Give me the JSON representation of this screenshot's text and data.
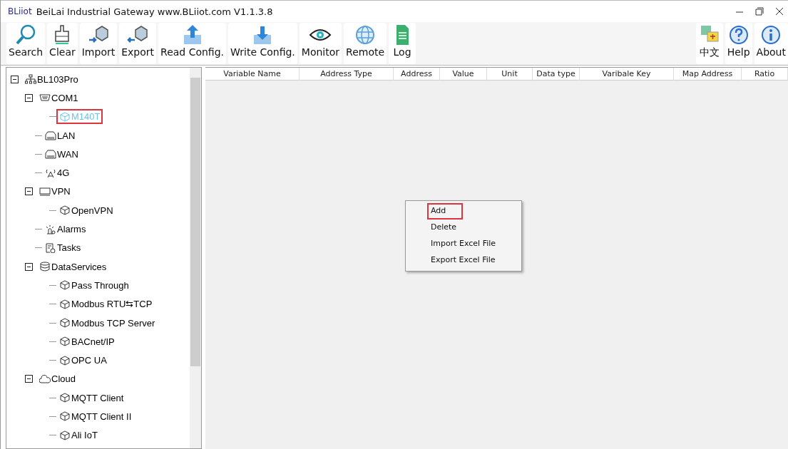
{
  "window": {
    "logo": "BLiiot",
    "title": "BeiLai Industrial Gateway www.BLiiot.com V1.1.3.8"
  },
  "toolbar": [
    {
      "label": "Search",
      "kind": "search"
    },
    {
      "label": "Clear",
      "kind": "clear"
    },
    {
      "label": "Import",
      "kind": "import"
    },
    {
      "label": "Export",
      "kind": "export"
    },
    {
      "label": "Read Config.",
      "kind": "read"
    },
    {
      "label": "Write Config.",
      "kind": "write"
    },
    {
      "label": "Monitor",
      "kind": "monitor"
    },
    {
      "label": "Remote",
      "kind": "remote"
    },
    {
      "label": "Log",
      "kind": "log"
    }
  ],
  "toolbar_right": [
    {
      "label": "中文",
      "kind": "language"
    },
    {
      "label": "Help",
      "kind": "help"
    },
    {
      "label": "About",
      "kind": "about"
    }
  ],
  "tree": [
    {
      "label": "BL103Pro",
      "kind": "network",
      "expanded": true,
      "selected": false,
      "highlighted": false,
      "children": [
        {
          "label": "COM1",
          "kind": "serial",
          "expanded": true,
          "selected": false,
          "highlighted": false,
          "children": [
            {
              "label": "M140T",
              "kind": "device",
              "selected": true,
              "highlighted": true
            }
          ]
        },
        {
          "label": "LAN",
          "kind": "ethernet",
          "selected": false,
          "highlighted": false
        },
        {
          "label": "WAN",
          "kind": "ethernet",
          "selected": false,
          "highlighted": false
        },
        {
          "label": "4G",
          "kind": "antenna",
          "selected": false,
          "highlighted": false
        },
        {
          "label": "VPN",
          "kind": "vpn",
          "expanded": true,
          "selected": false,
          "highlighted": false,
          "children": [
            {
              "label": "OpenVPN",
              "kind": "device",
              "selected": false,
              "highlighted": false
            }
          ]
        },
        {
          "label": "Alarms",
          "kind": "alarm",
          "selected": false,
          "highlighted": false
        },
        {
          "label": "Tasks",
          "kind": "tasks",
          "selected": false,
          "highlighted": false
        },
        {
          "label": "DataServices",
          "kind": "database",
          "expanded": true,
          "selected": false,
          "highlighted": false,
          "children": [
            {
              "label": "Pass Through",
              "kind": "device",
              "selected": false,
              "highlighted": false
            },
            {
              "label": "Modbus RTU⇆TCP",
              "kind": "device",
              "selected": false,
              "highlighted": false
            },
            {
              "label": "Modbus TCP Server",
              "kind": "device",
              "selected": false,
              "highlighted": false
            },
            {
              "label": "BACnet/IP",
              "kind": "device",
              "selected": false,
              "highlighted": false
            },
            {
              "label": "OPC UA",
              "kind": "device",
              "selected": false,
              "highlighted": false
            }
          ]
        },
        {
          "label": "Cloud",
          "kind": "cloud",
          "expanded": true,
          "selected": false,
          "highlighted": false,
          "children": [
            {
              "label": "MQTT Client",
              "kind": "device",
              "selected": false,
              "highlighted": false
            },
            {
              "label": "MQTT Client II",
              "kind": "device",
              "selected": false,
              "highlighted": false
            },
            {
              "label": "Ali IoT",
              "kind": "device",
              "selected": false,
              "highlighted": false
            }
          ]
        }
      ]
    }
  ],
  "table": {
    "columns": [
      "Variable Name",
      "Address Type",
      "Address",
      "Value",
      "Unit",
      "Data type",
      "Varibale Key",
      "Map Address",
      "Ratio"
    ]
  },
  "context_menu": [
    {
      "label": "Add",
      "highlighted": true
    },
    {
      "label": "Delete",
      "highlighted": false
    },
    {
      "label": "Import Excel File",
      "highlighted": false
    },
    {
      "label": "Export Excel File",
      "highlighted": false
    }
  ]
}
